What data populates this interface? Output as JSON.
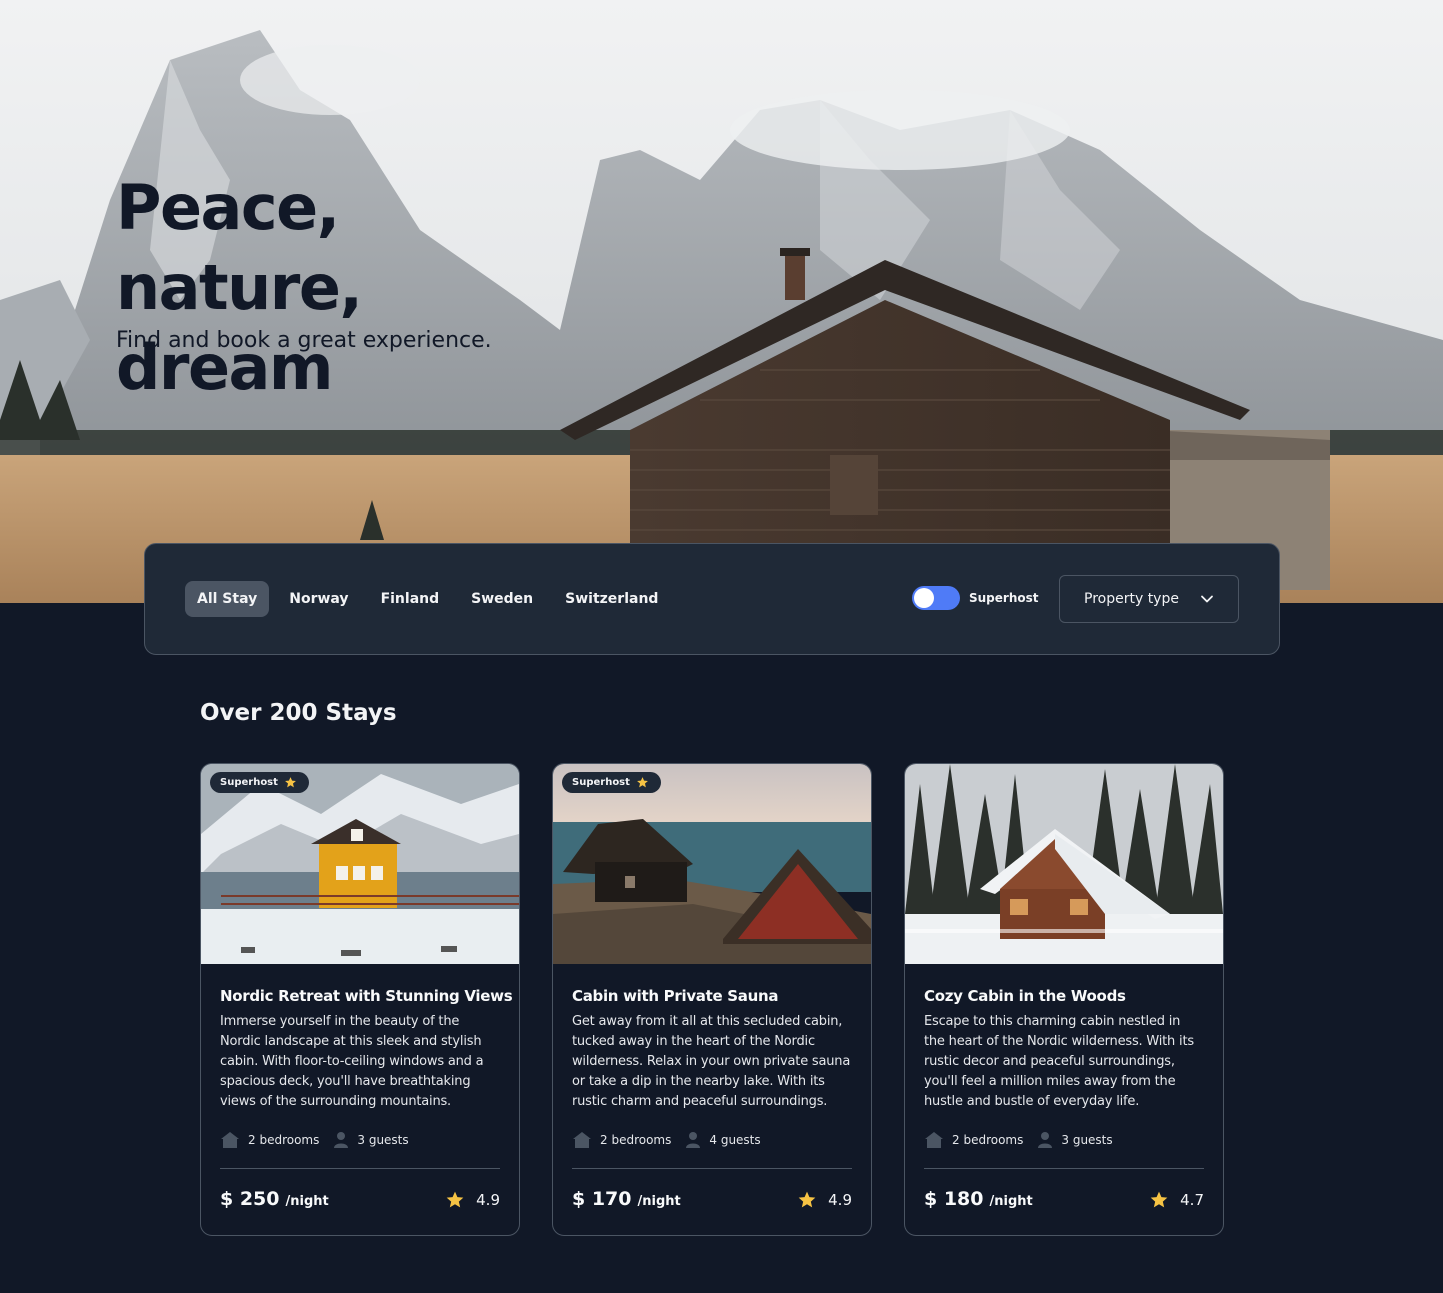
{
  "hero": {
    "title": "Peace, nature, dream",
    "subtitle": "Find and book a great experience."
  },
  "filters": {
    "tabs": [
      {
        "label": "All Stay",
        "active": true
      },
      {
        "label": "Norway",
        "active": false
      },
      {
        "label": "Finland",
        "active": false
      },
      {
        "label": "Sweden",
        "active": false
      },
      {
        "label": "Switzerland",
        "active": false
      }
    ],
    "superhost_label": "Superhost",
    "superhost_on": true,
    "property_type_label": "Property type"
  },
  "section": {
    "title": "Over 200 Stays"
  },
  "cards": [
    {
      "badge": "Superhost",
      "title": "Nordic Retreat with Stunning Views",
      "description": "Immerse yourself in the beauty of the Nordic landscape at this sleek and stylish cabin. With floor-to-ceiling windows and a spacious deck, you'll have breathtaking views of the surrounding mountains.",
      "bedrooms": "2 bedrooms",
      "guests": "3 guests",
      "price": "$ 250",
      "unit": "/night",
      "rating": "4.9"
    },
    {
      "badge": "Superhost",
      "title": "Cabin with Private Sauna",
      "description": "Get away from it all at this secluded cabin, tucked away in the heart of the Nordic wilderness. Relax in your own private sauna or take a dip in the nearby lake. With its rustic charm and peaceful surroundings.",
      "bedrooms": "2 bedrooms",
      "guests": "4 guests",
      "price": "$ 170",
      "unit": "/night",
      "rating": "4.9"
    },
    {
      "badge": "",
      "title": "Cozy Cabin in the Woods",
      "description": "Escape to this charming cabin nestled in the heart of the Nordic wilderness. With its rustic decor and peaceful surroundings, you'll feel a million miles away from the hustle and bustle of everyday life.",
      "bedrooms": "2 bedrooms",
      "guests": "3 guests",
      "price": "$ 180",
      "unit": "/night",
      "rating": "4.7"
    }
  ],
  "colors": {
    "page_bg": "#111827",
    "panel_bg": "#1f2937",
    "border": "#4b5563",
    "toggle_accent": "#4f7bf7",
    "star": "#f6c344"
  },
  "icons": {
    "chevron": "chevron-down-icon",
    "star": "star-icon",
    "home": "home-icon",
    "user": "user-icon"
  }
}
